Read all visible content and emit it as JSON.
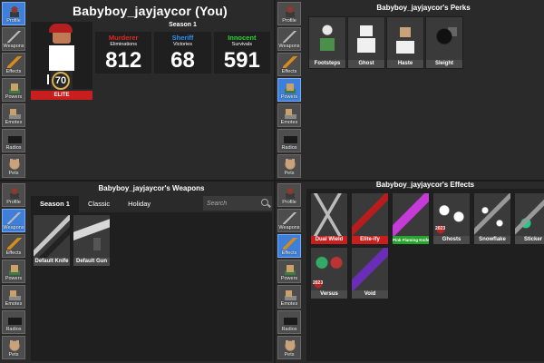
{
  "profile": {
    "username": "Babyboy_jayjaycor (You)",
    "level": "70",
    "badge": "ELITE",
    "season": "Season 1",
    "stats": [
      {
        "role": "Murderer",
        "sub": "Eliminations",
        "value": "812",
        "color": "#e02626"
      },
      {
        "role": "Sheriff",
        "sub": "Victories",
        "value": "68",
        "color": "#2f8ff0"
      },
      {
        "role": "Innocent",
        "sub": "Survivals",
        "value": "591",
        "color": "#2bd13a"
      }
    ]
  },
  "side_nav": [
    "Profile",
    "Weapons",
    "Effects",
    "Powers",
    "Emotes",
    "Radios",
    "Pets"
  ],
  "perks": {
    "title": "Babyboy_jayjaycor's Perks",
    "items": [
      "Footsteps",
      "Ghost",
      "Haste",
      "Sleight"
    ]
  },
  "weapons": {
    "title": "Babyboy_jayjaycor's Weapons",
    "tabs": [
      "Season 1",
      "Classic",
      "Holiday"
    ],
    "search_placeholder": "Search",
    "items": [
      "Default Knife",
      "Default Gun"
    ]
  },
  "effects": {
    "title": "Babyboy_jayjaycor's Effects",
    "items": [
      {
        "label": "Dual Wield",
        "style": "red"
      },
      {
        "label": "Elite-ify",
        "style": "red"
      },
      {
        "label": "Pink Flaming Knife",
        "style": "green"
      },
      {
        "label": "Ghosts",
        "style": "gray",
        "badge": "2023"
      },
      {
        "label": "Snowflake",
        "style": "gray"
      },
      {
        "label": "Sticker",
        "style": "gray"
      },
      {
        "label": "Versus",
        "style": "gray",
        "badge": "2023"
      },
      {
        "label": "Void",
        "style": "gray"
      }
    ]
  }
}
